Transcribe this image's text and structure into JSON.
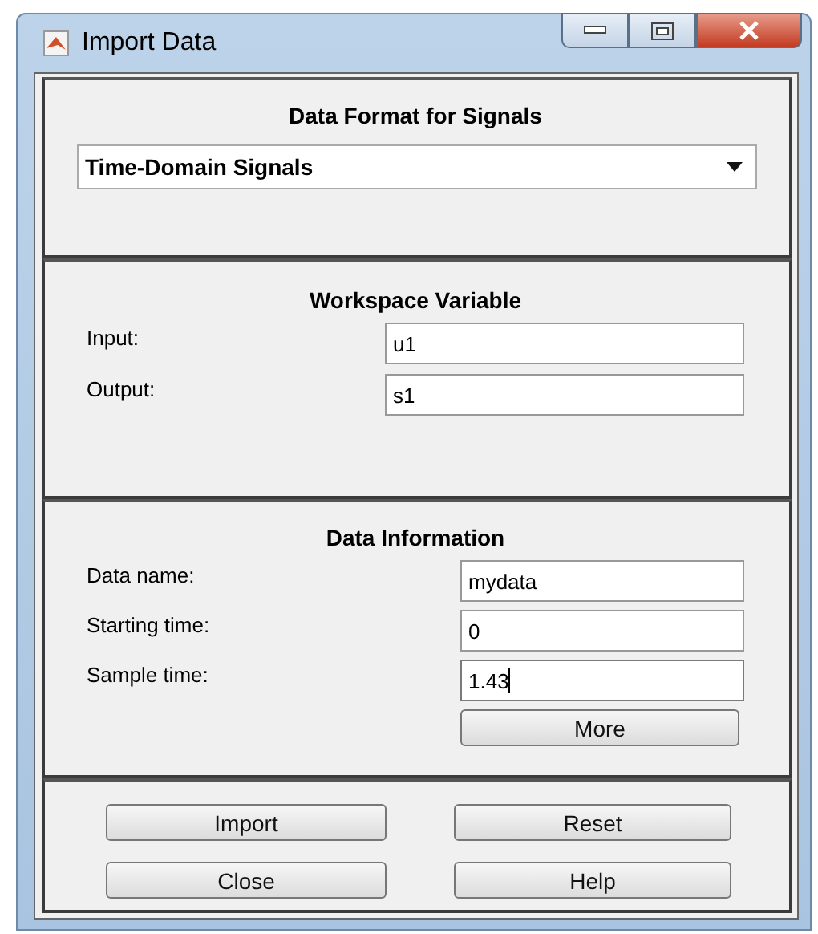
{
  "window": {
    "title": "Import Data"
  },
  "format_panel": {
    "title": "Data Format for Signals",
    "dropdown": {
      "value": "Time-Domain Signals"
    }
  },
  "workspace_panel": {
    "title": "Workspace Variable",
    "fields": [
      {
        "label": "Input:",
        "value": "u1",
        "focused": false
      },
      {
        "label": "Output:",
        "value": "s1",
        "focused": false
      }
    ]
  },
  "info_panel": {
    "title": "Data Information",
    "fields": [
      {
        "label": "Data name:",
        "value": "mydata",
        "focused": false
      },
      {
        "label": "Starting time:",
        "value": "0",
        "focused": false
      },
      {
        "label": "Sample time:",
        "value": "1.43",
        "focused": true
      }
    ],
    "more_button": "More"
  },
  "buttons": [
    "Import",
    "Reset",
    "Close",
    "Help"
  ]
}
